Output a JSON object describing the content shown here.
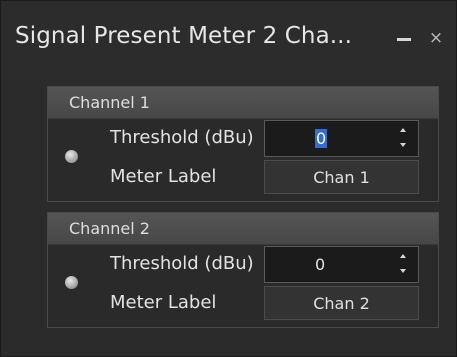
{
  "window": {
    "title": "Signal Present Meter 2 Cha...",
    "minimize_icon": "minimize-icon",
    "close_glyph": "×"
  },
  "channels": [
    {
      "header": "Channel 1",
      "threshold_label": "Threshold (dBu)",
      "threshold_value": "0",
      "threshold_selected": true,
      "meter_label_label": "Meter Label",
      "meter_label_value": "Chan 1"
    },
    {
      "header": "Channel 2",
      "threshold_label": "Threshold (dBu)",
      "threshold_value": "0",
      "threshold_selected": false,
      "meter_label_label": "Meter Label",
      "meter_label_value": "Chan 2"
    }
  ],
  "colors": {
    "background": "#2b2b2b",
    "header": "#4f4f4f",
    "selection": "#2f6fd1",
    "led": "#b0b0b0"
  }
}
